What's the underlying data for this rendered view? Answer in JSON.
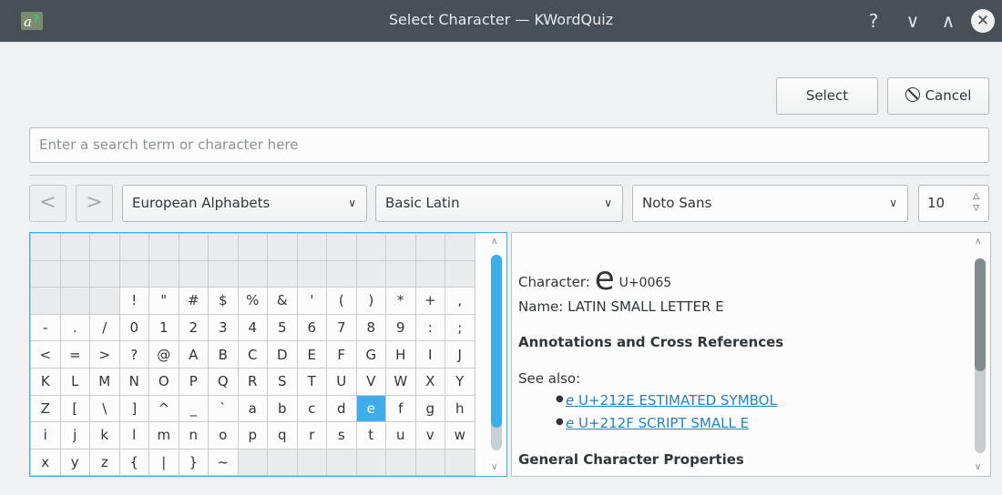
{
  "window": {
    "title": "Select Character — KWordQuiz",
    "help_glyph": "?",
    "minimize_glyph": "∨",
    "maximize_glyph": "∧",
    "close_glyph": "✕"
  },
  "buttons": {
    "select_label": "Select",
    "cancel_label": "Cancel"
  },
  "search": {
    "placeholder": "Enter a search term or character here"
  },
  "toolbar": {
    "back_glyph": "<",
    "forward_glyph": ">",
    "section": "European Alphabets",
    "block": "Basic Latin",
    "font": "Noto Sans",
    "font_size": "10"
  },
  "char_table": {
    "rows": [
      [
        "",
        "",
        "",
        "",
        "",
        "",
        "",
        "",
        "",
        "",
        "",
        "",
        "",
        "",
        "",
        ""
      ],
      [
        "",
        "",
        "",
        "",
        "",
        "",
        "",
        "",
        "",
        "",
        "",
        "",
        "",
        "",
        "",
        ""
      ],
      [
        "",
        "",
        "",
        "!",
        "\"",
        "#",
        "$",
        "%",
        "&",
        "'",
        "(",
        ")",
        "*",
        "+",
        ","
      ],
      [
        "-",
        ".",
        "/",
        "0",
        "1",
        "2",
        "3",
        "4",
        "5",
        "6",
        "7",
        "8",
        "9",
        ":",
        ";"
      ],
      [
        "<",
        "=",
        ">",
        "?",
        "@",
        "A",
        "B",
        "C",
        "D",
        "E",
        "F",
        "G",
        "H",
        "I",
        "J"
      ],
      [
        "K",
        "L",
        "M",
        "N",
        "O",
        "P",
        "Q",
        "R",
        "S",
        "T",
        "U",
        "V",
        "W",
        "X",
        "Y"
      ],
      [
        "Z",
        "[",
        "\\",
        "]",
        "^",
        "_",
        "`",
        "a",
        "b",
        "c",
        "d",
        "e",
        "f",
        "g",
        "h"
      ],
      [
        "i",
        "j",
        "k",
        "l",
        "m",
        "n",
        "o",
        "p",
        "q",
        "r",
        "s",
        "t",
        "u",
        "v",
        "w"
      ],
      [
        "x",
        "y",
        "z",
        "{",
        "|",
        "}",
        "~",
        "",
        "",
        "",
        "",
        "",
        "",
        "",
        ""
      ]
    ],
    "selected": "e"
  },
  "info": {
    "character_label": "Character:",
    "character": "e",
    "codepoint": "U+0065",
    "name": "Name: LATIN SMALL LETTER E",
    "annotations_heading": "Annotations and Cross References",
    "see_also_label": "See also:",
    "see_also": [
      {
        "glyph": "e",
        "text": "U+212E ESTIMATED SYMBOL"
      },
      {
        "glyph": "e",
        "text": "U+212F SCRIPT SMALL E"
      }
    ],
    "general_heading": "General Character Properties"
  },
  "colors": {
    "titlebar": "#475057",
    "accent": "#3daee9",
    "link": "#2980b9",
    "window_bg": "#eff0f1"
  },
  "icons": {
    "app": "kwordquiz-icon",
    "cancel": "cancel-circle-icon",
    "combo_arrow": "chevron-down-icon",
    "spin": "spin-arrows-icon"
  }
}
